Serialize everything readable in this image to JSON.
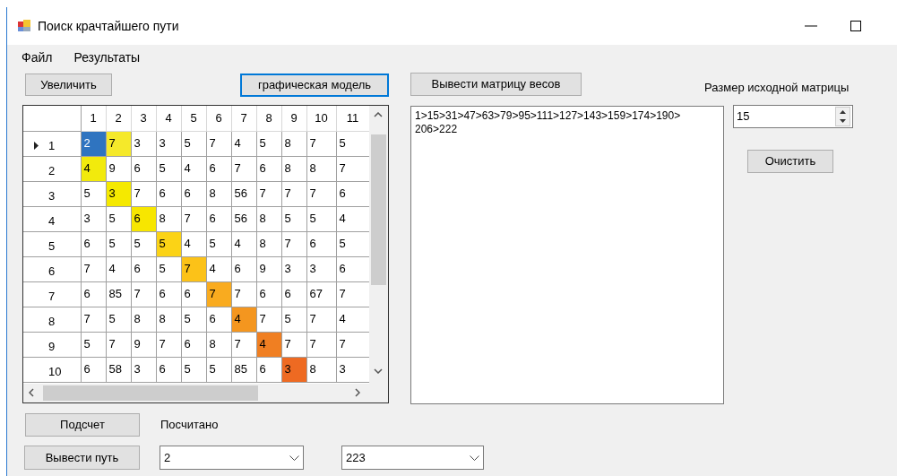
{
  "window": {
    "title": "Поиск крачтайшего пути"
  },
  "menu": [
    "Файл",
    "Результаты"
  ],
  "buttons": {
    "zoom": "Увеличить",
    "graph_model": "графическая модель",
    "show_weights": "Вывести матрицу весов",
    "clear": "Очистить",
    "compute": "Подсчет",
    "show_path": "Вывести путь"
  },
  "grid": {
    "columns": [
      "1",
      "2",
      "3",
      "4",
      "5",
      "6",
      "7",
      "8",
      "9",
      "10",
      "11"
    ],
    "rows": [
      {
        "header": "1",
        "current": true,
        "cells": [
          {
            "value": "2",
            "selected": true
          },
          {
            "value": "7",
            "selected": false,
            "color": "#f5e92a"
          },
          {
            "value": "3",
            "selected": false
          },
          {
            "value": "3",
            "selected": false
          },
          {
            "value": "5",
            "selected": false
          },
          {
            "value": "7",
            "selected": false
          },
          {
            "value": "4",
            "selected": false
          },
          {
            "value": "5",
            "selected": false
          },
          {
            "value": "8",
            "selected": false
          },
          {
            "value": "7",
            "selected": false
          },
          {
            "value": "5",
            "selected": false
          }
        ]
      },
      {
        "header": "2",
        "current": false,
        "cells": [
          {
            "value": "4",
            "selected": false,
            "color": "#f2ea0c"
          },
          {
            "value": "9",
            "selected": false
          },
          {
            "value": "6",
            "selected": false
          },
          {
            "value": "5",
            "selected": false
          },
          {
            "value": "4",
            "selected": false
          },
          {
            "value": "6",
            "selected": false
          },
          {
            "value": "7",
            "selected": false
          },
          {
            "value": "6",
            "selected": false
          },
          {
            "value": "8",
            "selected": false
          },
          {
            "value": "8",
            "selected": false
          },
          {
            "value": "7",
            "selected": false
          }
        ]
      },
      {
        "header": "3",
        "current": false,
        "cells": [
          {
            "value": "5",
            "selected": false
          },
          {
            "value": "3",
            "selected": false,
            "color": "#f5e900"
          },
          {
            "value": "7",
            "selected": false
          },
          {
            "value": "6",
            "selected": false
          },
          {
            "value": "6",
            "selected": false
          },
          {
            "value": "8",
            "selected": false
          },
          {
            "value": "56",
            "selected": false
          },
          {
            "value": "7",
            "selected": false
          },
          {
            "value": "7",
            "selected": false
          },
          {
            "value": "7",
            "selected": false
          },
          {
            "value": "6",
            "selected": false
          }
        ]
      },
      {
        "header": "4",
        "current": false,
        "cells": [
          {
            "value": "3",
            "selected": false
          },
          {
            "value": "5",
            "selected": false
          },
          {
            "value": "6",
            "selected": false,
            "color": "#f7e600"
          },
          {
            "value": "8",
            "selected": false
          },
          {
            "value": "7",
            "selected": false
          },
          {
            "value": "6",
            "selected": false
          },
          {
            "value": "56",
            "selected": false
          },
          {
            "value": "8",
            "selected": false
          },
          {
            "value": "5",
            "selected": false
          },
          {
            "value": "5",
            "selected": false
          },
          {
            "value": "4",
            "selected": false
          }
        ]
      },
      {
        "header": "5",
        "current": false,
        "cells": [
          {
            "value": "6",
            "selected": false
          },
          {
            "value": "5",
            "selected": false
          },
          {
            "value": "5",
            "selected": false
          },
          {
            "value": "5",
            "selected": false,
            "color": "#fbd316"
          },
          {
            "value": "4",
            "selected": false
          },
          {
            "value": "5",
            "selected": false
          },
          {
            "value": "4",
            "selected": false
          },
          {
            "value": "8",
            "selected": false
          },
          {
            "value": "7",
            "selected": false
          },
          {
            "value": "6",
            "selected": false
          },
          {
            "value": "5",
            "selected": false
          }
        ]
      },
      {
        "header": "6",
        "current": false,
        "cells": [
          {
            "value": "7",
            "selected": false
          },
          {
            "value": "4",
            "selected": false
          },
          {
            "value": "6",
            "selected": false
          },
          {
            "value": "5",
            "selected": false
          },
          {
            "value": "7",
            "selected": false,
            "color": "#fcc218"
          },
          {
            "value": "4",
            "selected": false
          },
          {
            "value": "6",
            "selected": false
          },
          {
            "value": "9",
            "selected": false
          },
          {
            "value": "3",
            "selected": false
          },
          {
            "value": "3",
            "selected": false
          },
          {
            "value": "6",
            "selected": false
          }
        ]
      },
      {
        "header": "7",
        "current": false,
        "cells": [
          {
            "value": "6",
            "selected": false
          },
          {
            "value": "85",
            "selected": false
          },
          {
            "value": "7",
            "selected": false
          },
          {
            "value": "6",
            "selected": false
          },
          {
            "value": "6",
            "selected": false
          },
          {
            "value": "7",
            "selected": false,
            "color": "#f9ab1f"
          },
          {
            "value": "7",
            "selected": false
          },
          {
            "value": "6",
            "selected": false
          },
          {
            "value": "6",
            "selected": false
          },
          {
            "value": "67",
            "selected": false
          },
          {
            "value": "7",
            "selected": false
          }
        ]
      },
      {
        "header": "8",
        "current": false,
        "cells": [
          {
            "value": "7",
            "selected": false
          },
          {
            "value": "5",
            "selected": false
          },
          {
            "value": "8",
            "selected": false
          },
          {
            "value": "8",
            "selected": false
          },
          {
            "value": "5",
            "selected": false
          },
          {
            "value": "6",
            "selected": false
          },
          {
            "value": "4",
            "selected": false,
            "color": "#f4961f"
          },
          {
            "value": "7",
            "selected": false
          },
          {
            "value": "5",
            "selected": false
          },
          {
            "value": "7",
            "selected": false
          },
          {
            "value": "4",
            "selected": false
          }
        ]
      },
      {
        "header": "9",
        "current": false,
        "cells": [
          {
            "value": "5",
            "selected": false
          },
          {
            "value": "7",
            "selected": false
          },
          {
            "value": "9",
            "selected": false
          },
          {
            "value": "7",
            "selected": false
          },
          {
            "value": "6",
            "selected": false
          },
          {
            "value": "8",
            "selected": false
          },
          {
            "value": "7",
            "selected": false
          },
          {
            "value": "4",
            "selected": false,
            "color": "#f07f22"
          },
          {
            "value": "7",
            "selected": false
          },
          {
            "value": "7",
            "selected": false
          },
          {
            "value": "7",
            "selected": false
          }
        ]
      },
      {
        "header": "10",
        "current": false,
        "cells": [
          {
            "value": "6",
            "selected": false
          },
          {
            "value": "58",
            "selected": false
          },
          {
            "value": "3",
            "selected": false
          },
          {
            "value": "6",
            "selected": false
          },
          {
            "value": "5",
            "selected": false
          },
          {
            "value": "5",
            "selected": false
          },
          {
            "value": "85",
            "selected": false
          },
          {
            "value": "6",
            "selected": false
          },
          {
            "value": "3",
            "selected": false,
            "color": "#ee6a22"
          },
          {
            "value": "8",
            "selected": false
          },
          {
            "value": "3",
            "selected": false
          }
        ]
      }
    ]
  },
  "path_output": {
    "value": "1>15>31>47>63>79>95>111>127>143>159>174>190>206>222"
  },
  "matrix_size": {
    "label": "Размер исходной матрицы",
    "value": "15"
  },
  "status": "Посчитано",
  "from_select": {
    "value": "2"
  },
  "to_select": {
    "value": "223"
  }
}
